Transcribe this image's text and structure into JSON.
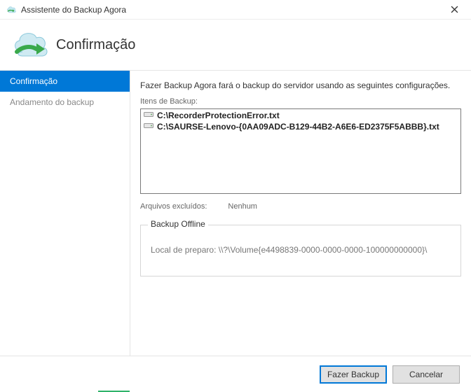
{
  "window": {
    "title": "Assistente do Backup Agora"
  },
  "header": {
    "heading": "Confirmação"
  },
  "sidebar": {
    "items": [
      {
        "label": "Confirmação",
        "active": true
      },
      {
        "label": "Andamento do backup",
        "active": false
      }
    ]
  },
  "main": {
    "intro": "Fazer Backup Agora fará o backup do servidor usando as seguintes configurações.",
    "items_label": "Itens de Backup:",
    "backup_items": [
      "C:\\RecorderProtectionError.txt",
      "C:\\SAURSE-Lenovo-{0AA09ADC-B129-44B2-A6E6-ED2375F5ABBB}.txt"
    ],
    "excluded_label": "Arquivos excluídos:",
    "excluded_value": "Nenhum",
    "offline_group": {
      "legend": "Backup Offline",
      "staging": "Local de preparo: \\\\?\\Volume{e4498839-0000-0000-0000-100000000000}\\"
    }
  },
  "footer": {
    "primary": "Fazer Backup",
    "cancel": "Cancelar"
  }
}
